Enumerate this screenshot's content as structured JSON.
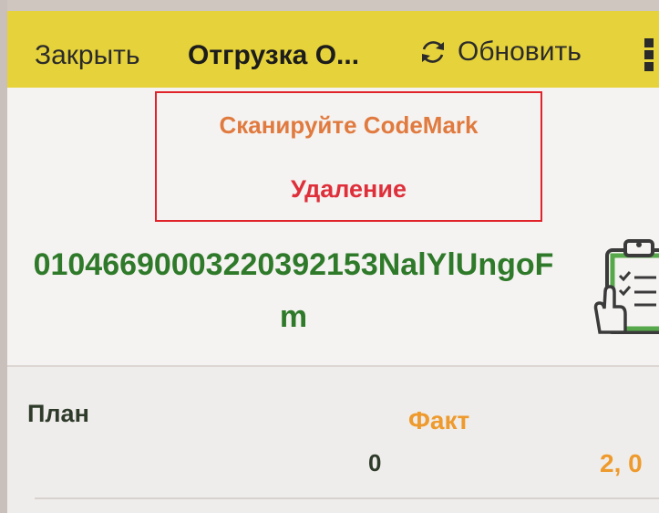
{
  "toolbar": {
    "close_label": "Закрыть",
    "title": "Отгрузка О...",
    "refresh_label": "Обновить",
    "refresh_icon": "refresh-icon",
    "more_icon": "more-vertical-icon",
    "background_color": "#e6d23a"
  },
  "status": {
    "scan_message": "Сканируйте CodeMark",
    "mode_message": "Удаление",
    "scan_color": "#e07a3f",
    "mode_color": "#de2f3a",
    "border_color": "#e0232b"
  },
  "scanned": {
    "code": "0104669000322039215 3NalYlUngoFm",
    "code_line1": "0104669000322039215",
    "code_line2": "3NalYlUngoFm",
    "code_color": "#2f7a2a",
    "icon": "clipboard-checklist-icon"
  },
  "quantities": {
    "plan_label": "План",
    "fact_label": "Факт",
    "plan_value": "0",
    "fact_value": "2, 0",
    "fact_color": "#ee9a2d"
  }
}
